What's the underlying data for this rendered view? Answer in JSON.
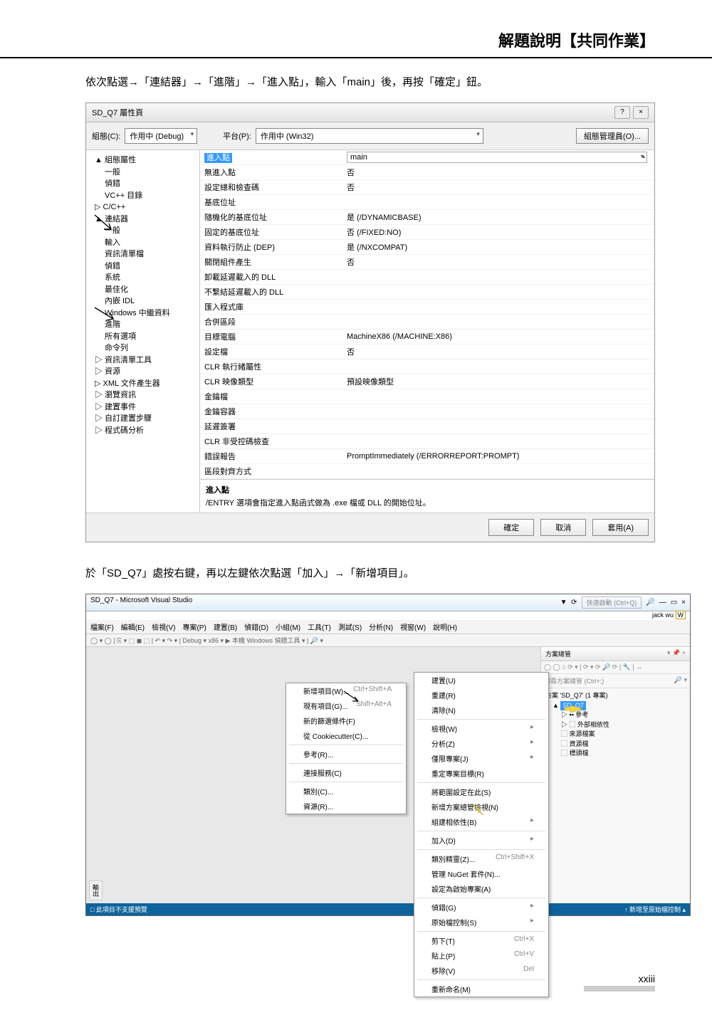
{
  "page": {
    "header_title": "解題說明【共同作業】",
    "instruction1": "依次點選→「連結器」→「進階」→「進入點」，輸入「main」後，再按「確定」鈕。",
    "instruction2": "於「SD_Q7」處按右鍵，再以左鍵依次點選「加入」→「新增項目」。",
    "pagenum": "xxiii"
  },
  "dialog1": {
    "title": "SD_Q7 屬性頁",
    "help_icon": "?",
    "close_icon": "×",
    "config_label": "組態(C):",
    "config_value": "作用中 (Debug)",
    "platform_label": "平台(P):",
    "platform_value": "作用中 (Win32)",
    "config_mgr": "組態管理員(O)...",
    "tree": {
      "root": "▲ 組態屬性",
      "items": [
        "一般",
        "偵錯",
        "VC++ 目錄",
        "▷  C/C++",
        "▲ 連結器",
        "一般",
        "輸入",
        "資訊清單檔",
        "偵錯",
        "系統",
        "最佳化",
        "內嵌 IDL",
        "Windows 中繼資料",
        "進階",
        "所有選項",
        "命令列",
        "▷  資訊清單工具",
        "▷  資源",
        "▷  XML 文件產生器",
        "▷  瀏覽資訊",
        "▷  建置事件",
        "▷  自訂建置步驟",
        "▷  程式碼分析"
      ]
    },
    "grid_rows": [
      {
        "k": "進入點",
        "v": "main",
        "hl": true
      },
      {
        "k": "無進入點",
        "v": "否"
      },
      {
        "k": "設定總和檢查碼",
        "v": "否"
      },
      {
        "k": "基底位址",
        "v": ""
      },
      {
        "k": "隨機化的基底位址",
        "v": "是 (/DYNAMICBASE)"
      },
      {
        "k": "固定的基底位址",
        "v": "否 (/FIXED:NO)"
      },
      {
        "k": "資料執行防止 (DEP)",
        "v": "是 (/NXCOMPAT)"
      },
      {
        "k": "關閉組件產生",
        "v": "否"
      },
      {
        "k": "卸載延遲載入的 DLL",
        "v": ""
      },
      {
        "k": "不繫結延遲載入的 DLL",
        "v": ""
      },
      {
        "k": "匯入程式庫",
        "v": ""
      },
      {
        "k": "合併區段",
        "v": ""
      },
      {
        "k": "目標電腦",
        "v": "MachineX86 (/MACHINE:X86)"
      },
      {
        "k": "設定檔",
        "v": "否"
      },
      {
        "k": "CLR 執行緒屬性",
        "v": ""
      },
      {
        "k": "CLR 映像類型",
        "v": "預設映像類型"
      },
      {
        "k": "金鑰檔",
        "v": ""
      },
      {
        "k": "金鑰容器",
        "v": ""
      },
      {
        "k": "延遲簽署",
        "v": ""
      },
      {
        "k": "CLR 非受控碼檢查",
        "v": ""
      },
      {
        "k": "錯誤報告",
        "v": "PromptImmediately (/ERRORREPORT:PROMPT)"
      },
      {
        "k": "區段對齊方式",
        "v": ""
      }
    ],
    "desc_title": "進入點",
    "desc_body": "/ENTRY 選項會指定進入點函式做為 .exe 檔或 DLL 的開始位址。",
    "btn_ok": "確定",
    "btn_cancel": "取消",
    "btn_apply": "套用(A)"
  },
  "vs": {
    "title": "SD_Q7 - Microsoft Visual Studio",
    "quick_launch": "快速啟動 (Ctrl+Q)",
    "user": "jack wu",
    "menubar": [
      "檔案(F)",
      "編輯(E)",
      "檢視(V)",
      "專案(P)",
      "建置(B)",
      "偵錯(D)",
      "小組(M)",
      "工具(T)",
      "測試(S)",
      "分析(N)",
      "視窗(W)",
      "說明(H)"
    ],
    "toolbar": "◯ ▾ ◯  | ⎘ ▾ ⬚  ◼ ⬚ | ↶ ▾ ↷ ▾ |  Debug  ▾   x86       ▾  ▶ 本機 Windows 偵錯工具 ▾  |  🔎  ▾",
    "se_title": "方案總管",
    "se_toolbar": "◯ ◯ ⌂ ⟳ ▾ | ⟳ ▾ ⟳ 🔎 ⟳ |  🔧 | ↔",
    "se_search": "搜尋方案總管 (Ctrl+;)",
    "se_tree": {
      "sol": "方案 'SD_Q7' (1 專案)",
      "proj": "SD_Q7",
      "items": [
        "▷  ▪▪ 參考",
        "▷  ⬚ 外部相依性",
        "⬚ 來源檔案",
        "⬚ 資源檔",
        "⬚ 標頭檔"
      ]
    },
    "ctx1": [
      {
        "t": "新增項目(W)...",
        "sc": "Ctrl+Shift+A"
      },
      {
        "t": "現有項目(G)...",
        "sc": "Shift+Alt+A"
      },
      {
        "t": "新的篩選條件(F)"
      },
      {
        "t": "從 Cookiecutter(C)..."
      },
      {
        "t": "參考(R)..."
      },
      {
        "t": "連接服務(C)"
      },
      {
        "t": "類別(C)..."
      },
      {
        "t": "資源(R)..."
      }
    ],
    "ctx2": [
      {
        "t": "建置(U)"
      },
      {
        "t": "重建(R)"
      },
      {
        "t": "清除(N)"
      },
      {
        "t": "檢視(W)",
        "arr": true
      },
      {
        "t": "分析(Z)",
        "arr": true
      },
      {
        "t": "僅限專案(J)",
        "arr": true
      },
      {
        "t": "重定專案目標(R)"
      },
      {
        "t": "將範圍設定在此(S)"
      },
      {
        "t": "新增方案總管檢視(N)"
      },
      {
        "t": "組建相依性(B)",
        "arr": true
      },
      {
        "t": "加入(D)",
        "arr": true
      },
      {
        "t": "類別精靈(Z)...",
        "sc": "Ctrl+Shift+X"
      },
      {
        "t": "管理 NuGet 套件(N)..."
      },
      {
        "t": "設定為啟始專案(A)"
      },
      {
        "t": "偵錯(G)",
        "arr": true
      },
      {
        "t": "原始檔控制(S)",
        "arr": true
      },
      {
        "t": "剪下(T)",
        "sc": "Ctrl+X"
      },
      {
        "t": "貼上(P)",
        "sc": "Ctrl+V"
      },
      {
        "t": "移除(V)",
        "sc": "Del"
      },
      {
        "t": "重新命名(M)"
      }
    ],
    "status_left": "□ 此項目不支援預覽",
    "status_right": "↑ 新增至原始檔控制 ▴",
    "output_label": "輸出"
  }
}
